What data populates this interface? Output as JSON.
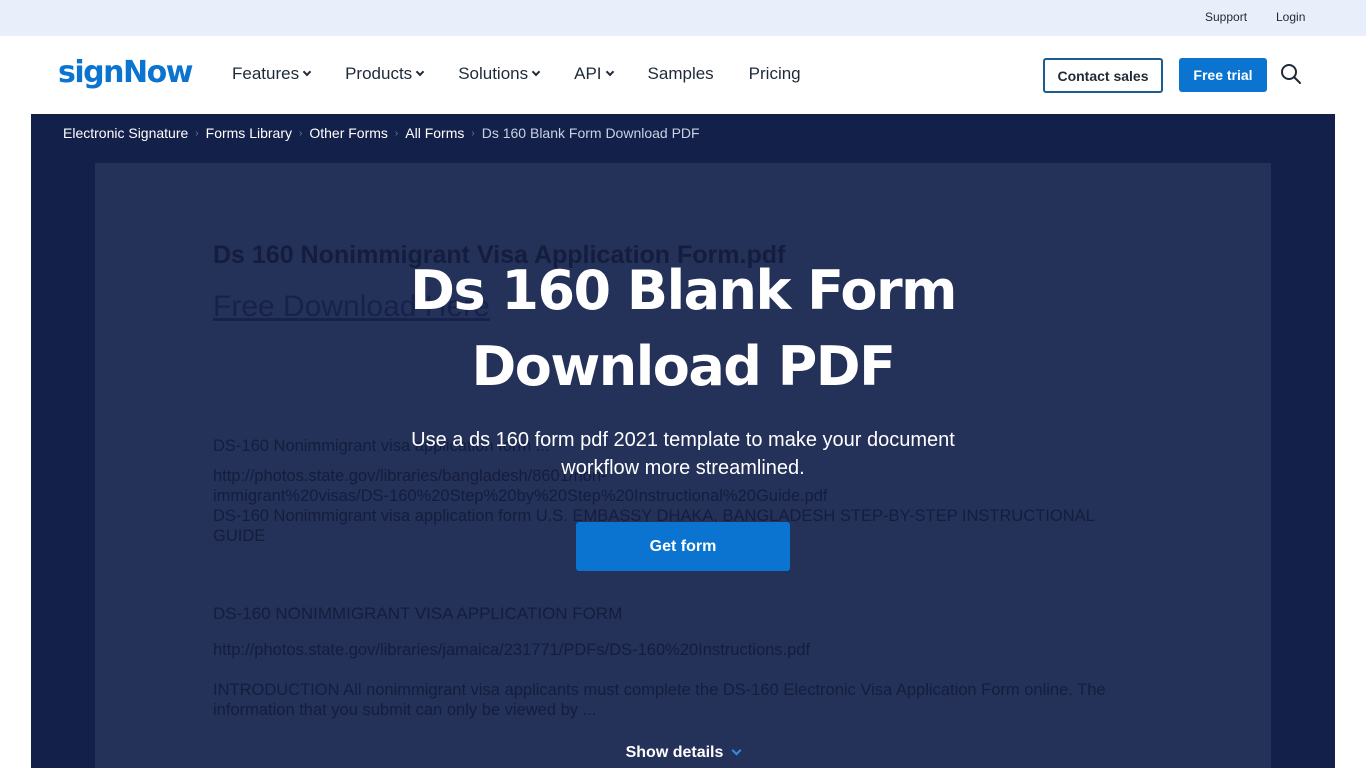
{
  "topbar": {
    "support": "Support",
    "login": "Login"
  },
  "header": {
    "logo": "signNow",
    "nav": [
      {
        "label": "Features",
        "has_dropdown": true
      },
      {
        "label": "Products",
        "has_dropdown": true
      },
      {
        "label": "Solutions",
        "has_dropdown": true
      },
      {
        "label": "API",
        "has_dropdown": true
      },
      {
        "label": "Samples",
        "has_dropdown": false
      },
      {
        "label": "Pricing",
        "has_dropdown": false
      }
    ],
    "contact_sales": "Contact sales",
    "free_trial": "Free trial",
    "search_icon": "search-icon"
  },
  "breadcrumb": [
    "Electronic Signature",
    "Forms Library",
    "Other Forms",
    "All Forms",
    "Ds 160 Blank Form Download PDF"
  ],
  "hero": {
    "title_line1": "Ds 160 Blank Form",
    "title_line2": "Download PDF",
    "description_line1": "Use a ds 160 form pdf 2021 template to make your document",
    "description_line2": "workflow more streamlined.",
    "get_form": "Get form",
    "show_details": "Show details"
  },
  "document_preview": {
    "title": "Ds 160 Nonimmigrant Visa Application Form.pdf",
    "link": "Free Download Here",
    "p1": "DS-160 Nonimmigrant visa application form ...",
    "p2_line1": "http://photos.state.gov/libraries/bangladesh/8601/non-",
    "p2_line2": "immigrant%20visas/DS-160%20Step%20by%20Step%20Instructional%20Guide.pdf",
    "p2_line3": "DS-160 Nonimmigrant visa application form U.S. EMBASSY DHAKA, BANGLADESH STEP-BY-STEP INSTRUCTIONAL",
    "p2_line4": "GUIDE",
    "p3": "DS-160 NONIMMIGRANT VISA APPLICATION FORM",
    "p4": "http://photos.state.gov/libraries/jamaica/231771/PDFs/DS-160%20Instructions.pdf",
    "p5_line1": "INTRODUCTION All nonimmigrant visa applicants must complete the DS-160 Electronic Visa Application Form online. The",
    "p5_line2": "information that you submit can only be viewed by ..."
  },
  "colors": {
    "brand_blue": "#0b74d0",
    "hero_bg": "#132049",
    "preview_bg": "#243159",
    "topbar_bg": "#e8effb"
  }
}
